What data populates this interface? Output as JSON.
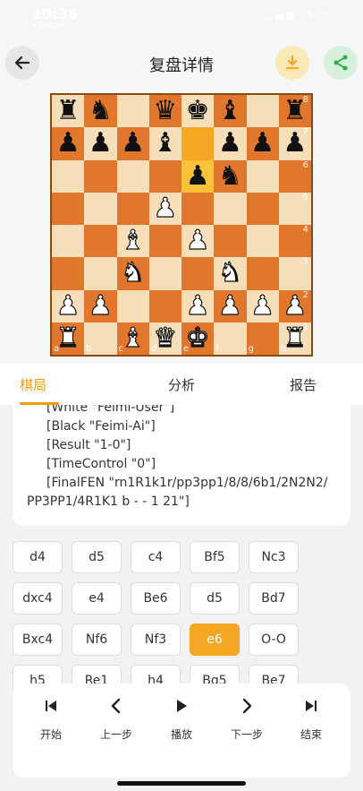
{
  "status_bar": {
    "time": "10:38",
    "subtitle": "◂ WeChat",
    "icons": "▂▄▆ ◔ ▭"
  },
  "header": {
    "title": "复盘详情",
    "back_icon": "arrow-left-icon",
    "download_icon": "download-icon",
    "share_icon": "share-icon"
  },
  "colors": {
    "accent": "#f5a623",
    "board_light": "#f6dfb8",
    "board_dark": "#e0772c",
    "highlight_from": "#f5a623",
    "highlight_to": "#fbc13a"
  },
  "board": {
    "ranks": [
      "8",
      "7",
      "6",
      "5",
      "4",
      "3",
      "2",
      "1"
    ],
    "files": [
      "a",
      "b",
      "c",
      "d",
      "e",
      "f",
      "g",
      "h"
    ],
    "rows": [
      [
        "br",
        "bn",
        "",
        "bq",
        "bk",
        "bb",
        "",
        "br"
      ],
      [
        "bp",
        "bp",
        "bp",
        "bb",
        "",
        "bp",
        "bp",
        "bp"
      ],
      [
        "",
        "",
        "",
        "",
        "bp",
        "bn",
        "",
        ""
      ],
      [
        "",
        "",
        "",
        "wp",
        "",
        "",
        "",
        ""
      ],
      [
        "",
        "",
        "wb",
        "",
        "wp",
        "",
        "",
        ""
      ],
      [
        "",
        "",
        "wn",
        "",
        "",
        "wn",
        "",
        ""
      ],
      [
        "wp",
        "wp",
        "",
        "",
        "wp",
        "wp",
        "wp",
        "wp"
      ],
      [
        "wr",
        "",
        "wb",
        "wq",
        "wk",
        "",
        "",
        "wr"
      ]
    ],
    "highlight": {
      "from": "e7",
      "to": "e6"
    }
  },
  "tabs": [
    "棋局",
    "分析",
    "报告"
  ],
  "active_tab": 0,
  "pgn_lines": [
    "[White \"Feimi-User\"]",
    "[Black \"Feimi-Ai\"]",
    "[Result \"1-0\"]",
    "[TimeControl \"0\"]",
    "[FinalFEN \"rn1R1k1r/pp3pp1/8/8/6b1/2N2N2/",
    "PP3PP1/4R1K1 b - - 1 21\"]"
  ],
  "moves": [
    [
      "d4",
      "d5",
      "c4",
      "Bf5",
      "Nc3"
    ],
    [
      "dxc4",
      "e4",
      "Be6",
      "d5",
      "Bd7"
    ],
    [
      "Bxc4",
      "Nf6",
      "Nf3",
      "e6",
      "O-O"
    ],
    [
      "h5",
      "Re1",
      "h4",
      "Bg5",
      "Be7"
    ]
  ],
  "active_move": "e6",
  "controls": [
    {
      "label": "开始",
      "icon": "skip-start-icon"
    },
    {
      "label": "上一步",
      "icon": "chevron-left-icon"
    },
    {
      "label": "播放",
      "icon": "play-icon"
    },
    {
      "label": "下一步",
      "icon": "chevron-right-icon"
    },
    {
      "label": "结束",
      "icon": "skip-end-icon"
    }
  ]
}
